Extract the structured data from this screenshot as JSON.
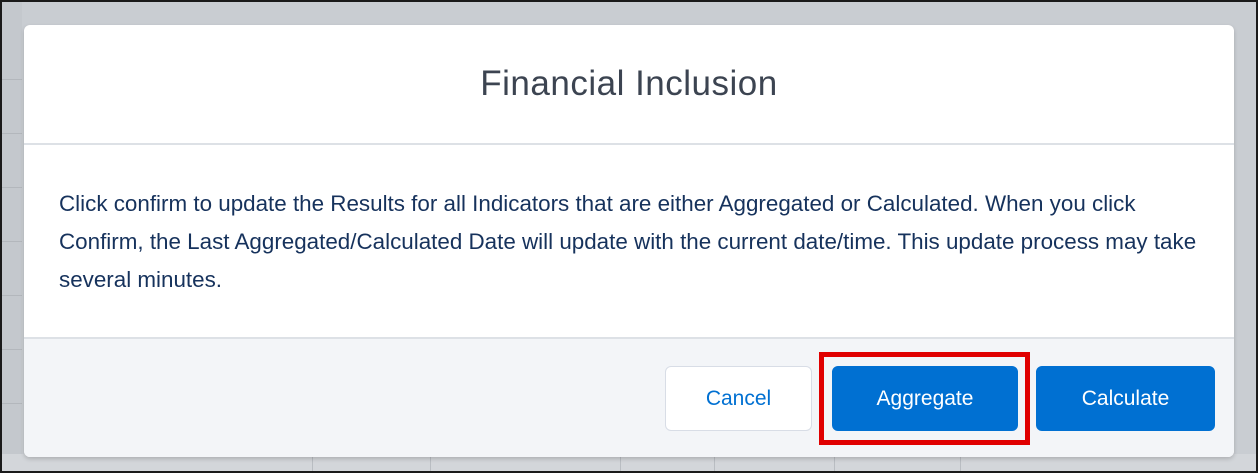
{
  "modal": {
    "title": "Financial Inclusion",
    "message": "Click confirm to update the Results for all Indicators that are either Aggregated or Calculated. When you click Confirm, the Last Aggregated/Calculated Date will update with the current date/time. This update process may take several minutes."
  },
  "footer": {
    "cancel_label": "Cancel",
    "aggregate_label": "Aggregate",
    "calculate_label": "Calculate"
  },
  "colors": {
    "brand": "#0070d2",
    "highlight": "#e00000",
    "title_text": "#3c4451",
    "body_text": "#16325c"
  }
}
